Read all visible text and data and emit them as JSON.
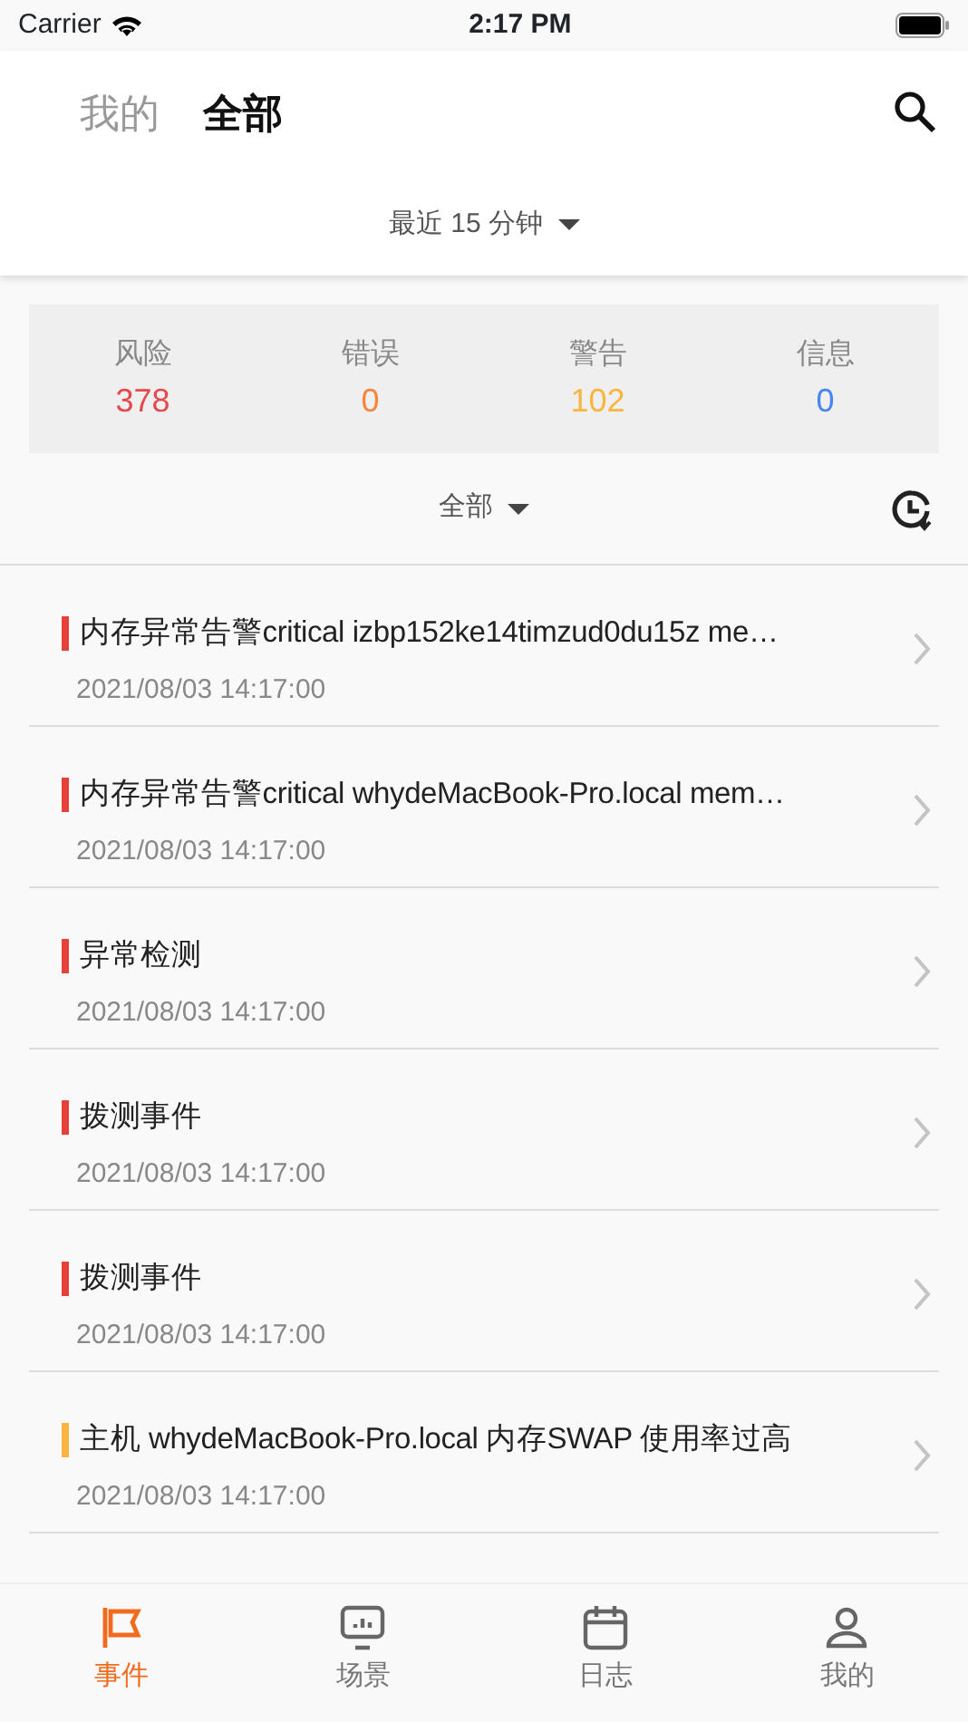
{
  "status_bar": {
    "carrier": "Carrier",
    "time": "2:17 PM"
  },
  "header_tabs": [
    {
      "label": "我的",
      "selected": false
    },
    {
      "label": "全部",
      "selected": true
    }
  ],
  "time_range": "最近 15 分钟",
  "stats": [
    {
      "label": "风险",
      "value": "378",
      "color": "#e5484d"
    },
    {
      "label": "错误",
      "value": "0",
      "color": "#f7853a"
    },
    {
      "label": "警告",
      "value": "102",
      "color": "#f9b53f"
    },
    {
      "label": "信息",
      "value": "0",
      "color": "#4a86f0"
    }
  ],
  "filter": "全部",
  "events": [
    {
      "title": "内存异常告警critical izbp152ke14timzud0du15z me…",
      "time": "2021/08/03 14:17:00",
      "color": "#e5403a"
    },
    {
      "title": "内存异常告警critical whydeMacBook-Pro.local mem…",
      "time": "2021/08/03 14:17:00",
      "color": "#e5403a"
    },
    {
      "title": "异常检测",
      "time": "2021/08/03 14:17:00",
      "color": "#e5403a"
    },
    {
      "title": "拨测事件",
      "time": "2021/08/03 14:17:00",
      "color": "#e5403a"
    },
    {
      "title": "拨测事件",
      "time": "2021/08/03 14:17:00",
      "color": "#e5403a"
    },
    {
      "title": "主机 whydeMacBook-Pro.local 内存SWAP 使用率过高",
      "time": "2021/08/03 14:17:00",
      "color": "#f9b53f"
    }
  ],
  "bottom_tabs": [
    {
      "label": "事件",
      "selected": true
    },
    {
      "label": "场景",
      "selected": false
    },
    {
      "label": "日志",
      "selected": false
    },
    {
      "label": "我的",
      "selected": false
    }
  ]
}
